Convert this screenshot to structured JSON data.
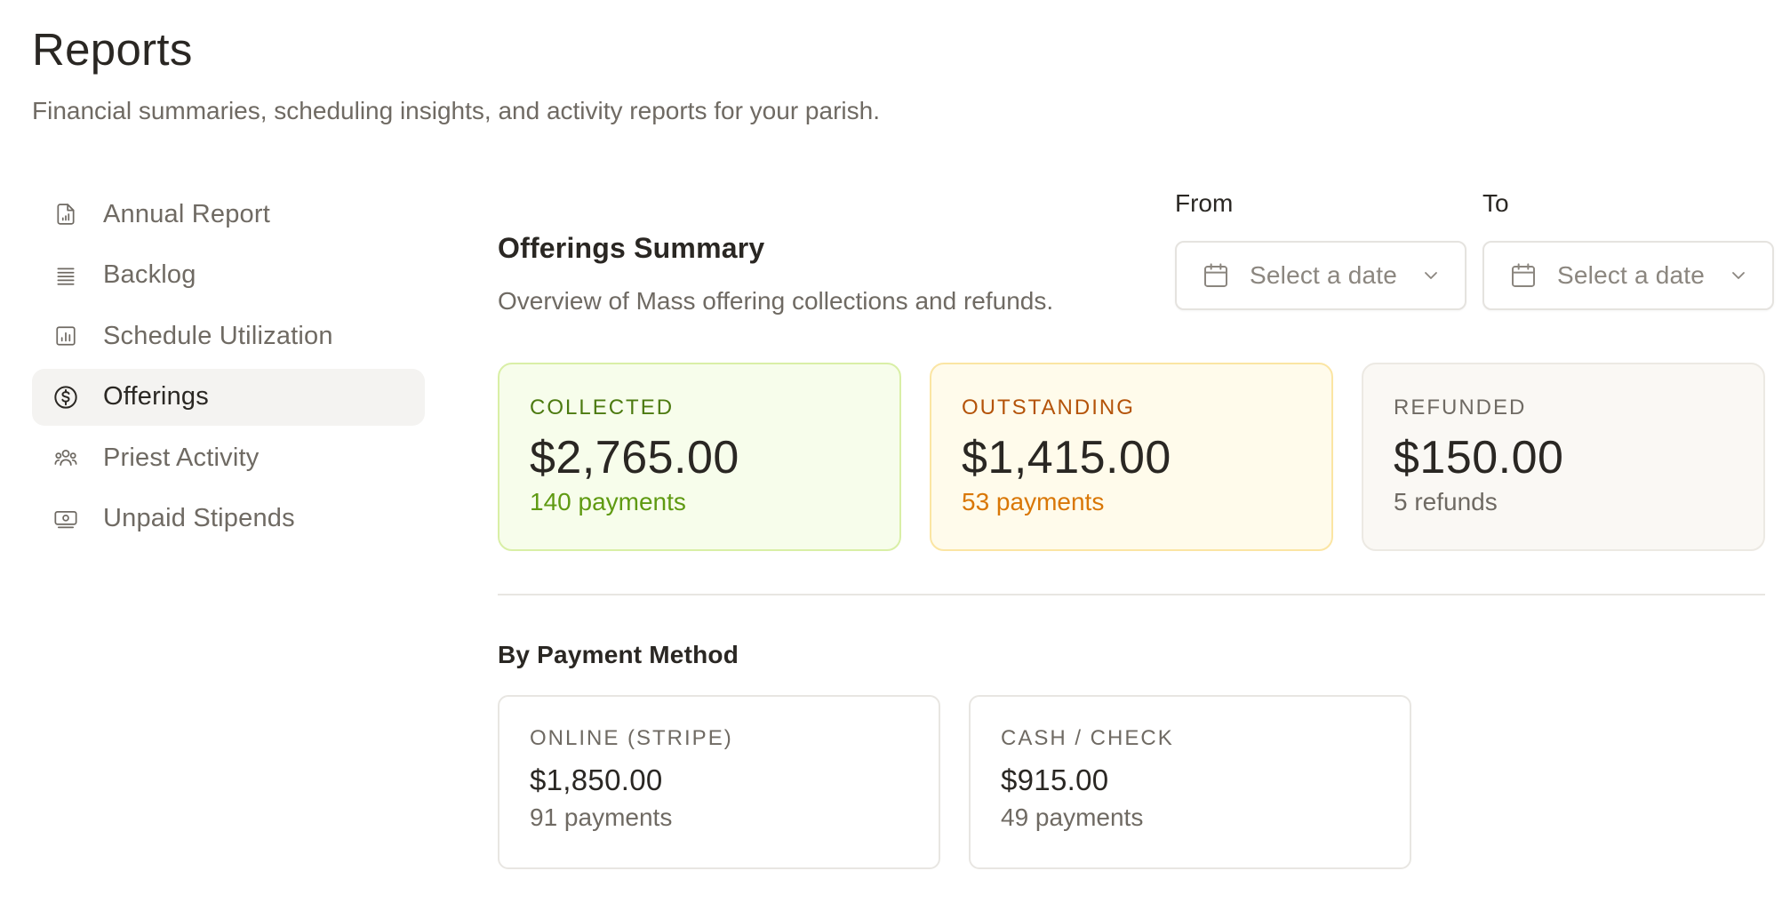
{
  "header": {
    "title": "Reports",
    "subtitle": "Financial summaries, scheduling insights, and activity reports for your parish."
  },
  "sidebar": {
    "items": [
      {
        "label": "Annual Report",
        "icon": "file-chart-icon",
        "active": false
      },
      {
        "label": "Backlog",
        "icon": "list-icon",
        "active": false
      },
      {
        "label": "Schedule Utilization",
        "icon": "bar-chart-icon",
        "active": false
      },
      {
        "label": "Offerings",
        "icon": "dollar-circle-icon",
        "active": true
      },
      {
        "label": "Priest Activity",
        "icon": "users-icon",
        "active": false
      },
      {
        "label": "Unpaid Stipends",
        "icon": "banknote-icon",
        "active": false
      }
    ]
  },
  "main": {
    "title": "Offerings Summary",
    "description": "Overview of Mass offering collections and refunds.",
    "filters": {
      "from_label": "From",
      "from_placeholder": "Select a date",
      "to_label": "To",
      "to_placeholder": "Select a date"
    },
    "stats": {
      "collected": {
        "label": "COLLECTED",
        "value": "$2,765.00",
        "sub": "140 payments"
      },
      "outstanding": {
        "label": "OUTSTANDING",
        "value": "$1,415.00",
        "sub": "53 payments"
      },
      "refunded": {
        "label": "REFUNDED",
        "value": "$150.00",
        "sub": "5 refunds"
      }
    },
    "by_method": {
      "title": "By Payment Method",
      "online": {
        "label": "ONLINE (STRIPE)",
        "value": "$1,850.00",
        "sub": "91 payments"
      },
      "cash": {
        "label": "CASH / CHECK",
        "value": "$915.00",
        "sub": "49 payments"
      }
    }
  },
  "colors": {
    "collected_accent": "#5f9a12",
    "outstanding_accent": "#d97706",
    "text_primary": "#2a2723",
    "text_muted": "#6f6a63"
  }
}
